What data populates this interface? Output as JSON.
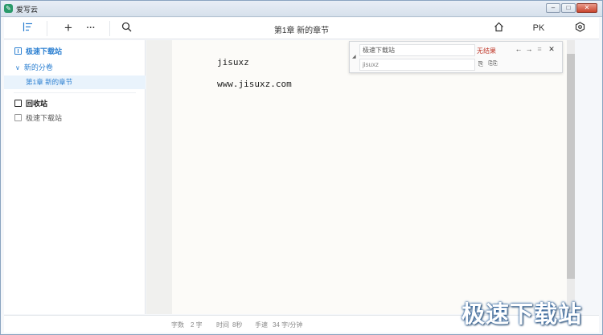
{
  "window": {
    "title": "爱写云",
    "minimize": "–",
    "maximize": "□",
    "close": "✕"
  },
  "toolbar": {
    "outline_icon": "outline-toggle-icon",
    "add_icon": "+",
    "more_icon": "···",
    "search_icon": "⌕",
    "chapter_title": "第1章  新的章节",
    "home_icon": "⌂",
    "pk_label": "PK",
    "settings_icon": "⬡"
  },
  "sidebar": {
    "book_title": "极速下载站",
    "volume": "新的分卷",
    "chapter": "第1章   新的章节",
    "trash": "回收站",
    "trash_item": "极速下载站"
  },
  "editor": {
    "lines": [
      "jisuxz",
      "www.jisuxz.com"
    ]
  },
  "find_panel": {
    "search_value": "极速下载站",
    "replace_value": "jisuxz",
    "result_text": "无结果",
    "toggle": "◢",
    "prev": "←",
    "next": "→",
    "options": "≡",
    "close": "✕",
    "replace_one": "⎘",
    "replace_all": "⎘⎘"
  },
  "status": {
    "word_count_label": "字数",
    "word_count_value": "2 字",
    "time_label": "时间",
    "time_value": "8秒",
    "speed_label": "手速",
    "speed_value": "34 字/分钟"
  },
  "watermark": "极速下载站",
  "colors": {
    "accent": "#2b7fd1",
    "no_result": "#c0392b",
    "paper": "#fcfbf8"
  }
}
